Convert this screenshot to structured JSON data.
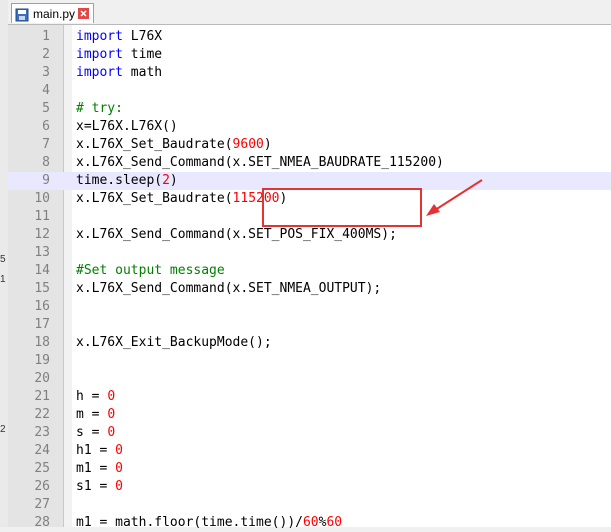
{
  "tab": {
    "filename": "main.py"
  },
  "left_strip_marks": [
    "5",
    "1",
    "2"
  ],
  "editor": {
    "current_line": 9,
    "lines": [
      {
        "num": "1",
        "tokens": [
          {
            "t": "import",
            "c": "kw"
          },
          {
            "t": " L76X",
            "c": ""
          }
        ]
      },
      {
        "num": "2",
        "tokens": [
          {
            "t": "import",
            "c": "kw"
          },
          {
            "t": " time",
            "c": ""
          }
        ]
      },
      {
        "num": "3",
        "tokens": [
          {
            "t": "import",
            "c": "kw"
          },
          {
            "t": " math",
            "c": ""
          }
        ]
      },
      {
        "num": "4",
        "tokens": []
      },
      {
        "num": "5",
        "tokens": [
          {
            "t": "# try:",
            "c": "cm"
          }
        ]
      },
      {
        "num": "6",
        "tokens": [
          {
            "t": "x=L76X.L76X()",
            "c": ""
          }
        ]
      },
      {
        "num": "7",
        "tokens": [
          {
            "t": "x.L76X_Set_Baudrate(",
            "c": ""
          },
          {
            "t": "9600",
            "c": "nm"
          },
          {
            "t": ")",
            "c": ""
          }
        ]
      },
      {
        "num": "8",
        "tokens": [
          {
            "t": "x.L76X_Send_Command(x.SET_NMEA_BAUDRATE_115200)",
            "c": ""
          }
        ]
      },
      {
        "num": "9",
        "tokens": [
          {
            "t": "time.sleep(",
            "c": ""
          },
          {
            "t": "2",
            "c": "nm"
          },
          {
            "t": ")",
            "c": ""
          }
        ]
      },
      {
        "num": "10",
        "tokens": [
          {
            "t": "x.L76X_Set_Baudrate(",
            "c": ""
          },
          {
            "t": "115200",
            "c": "nm"
          },
          {
            "t": ")",
            "c": ""
          }
        ]
      },
      {
        "num": "11",
        "tokens": []
      },
      {
        "num": "12",
        "tokens": [
          {
            "t": "x.L76X_Send_Command(x.SET_POS_FIX_400MS);",
            "c": ""
          }
        ]
      },
      {
        "num": "13",
        "tokens": []
      },
      {
        "num": "14",
        "tokens": [
          {
            "t": "#Set output message",
            "c": "cm"
          }
        ]
      },
      {
        "num": "15",
        "tokens": [
          {
            "t": "x.L76X_Send_Command(x.SET_NMEA_OUTPUT);",
            "c": ""
          }
        ]
      },
      {
        "num": "16",
        "tokens": []
      },
      {
        "num": "17",
        "tokens": []
      },
      {
        "num": "18",
        "tokens": [
          {
            "t": "x.L76X_Exit_BackupMode();",
            "c": ""
          }
        ]
      },
      {
        "num": "19",
        "tokens": []
      },
      {
        "num": "20",
        "tokens": []
      },
      {
        "num": "21",
        "tokens": [
          {
            "t": "h = ",
            "c": ""
          },
          {
            "t": "0",
            "c": "nm"
          }
        ]
      },
      {
        "num": "22",
        "tokens": [
          {
            "t": "m = ",
            "c": ""
          },
          {
            "t": "0",
            "c": "nm"
          }
        ]
      },
      {
        "num": "23",
        "tokens": [
          {
            "t": "s = ",
            "c": ""
          },
          {
            "t": "0",
            "c": "nm"
          }
        ]
      },
      {
        "num": "24",
        "tokens": [
          {
            "t": "h1 = ",
            "c": ""
          },
          {
            "t": "0",
            "c": "nm"
          }
        ]
      },
      {
        "num": "25",
        "tokens": [
          {
            "t": "m1 = ",
            "c": ""
          },
          {
            "t": "0",
            "c": "nm"
          }
        ]
      },
      {
        "num": "26",
        "tokens": [
          {
            "t": "s1 = ",
            "c": ""
          },
          {
            "t": "0",
            "c": "nm"
          }
        ]
      },
      {
        "num": "27",
        "tokens": []
      },
      {
        "num": "28",
        "tokens": [
          {
            "t": "m1 = math.floor(time.time())/",
            "c": ""
          },
          {
            "t": "60",
            "c": "nm"
          },
          {
            "t": "%",
            "c": ""
          },
          {
            "t": "60",
            "c": "nm"
          }
        ]
      }
    ]
  }
}
